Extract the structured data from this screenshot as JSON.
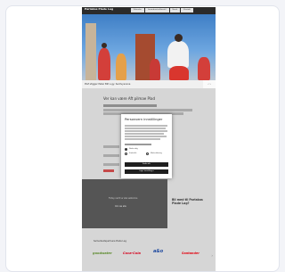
{
  "site": {
    "brand": "Pariakas Plade Lag",
    "tabs": [
      "Kalender",
      "Lavandrestreffamstil",
      "Norsk",
      "Kontakt"
    ]
  },
  "hero": {
    "caption": "Plaf stigger Peter Bilt s.gy. Sentvyscene",
    "arrows": "‹ ›"
  },
  "article": {
    "heading": "Ver kan være Aft pilmae Plad"
  },
  "cookie_modal": {
    "title": "Personvern innstillinger",
    "options": [
      "Nødvendig",
      "Statistikk",
      "Markedsføring"
    ],
    "accept_label": "Godta alle",
    "save_label": "Lagre innstillinger"
  },
  "promo": {
    "label": "Friday nacht er alle velkomne",
    "sub": "Om oss alle"
  },
  "sidebar": {
    "title": "Bli med til Pariakas Plade Lag?"
  },
  "sponsors": {
    "heading": "Samarbeidspartnere Plade Lag",
    "logos": [
      "goodwater",
      "Coca-Cola",
      "a&o",
      "Santander"
    ],
    "next": "›"
  },
  "colors": {
    "logo_goodwater": "#5b8a2b",
    "logo_coca": "#d6001c",
    "logo_ao": "#1f4aa0",
    "logo_santander": "#e30613"
  }
}
